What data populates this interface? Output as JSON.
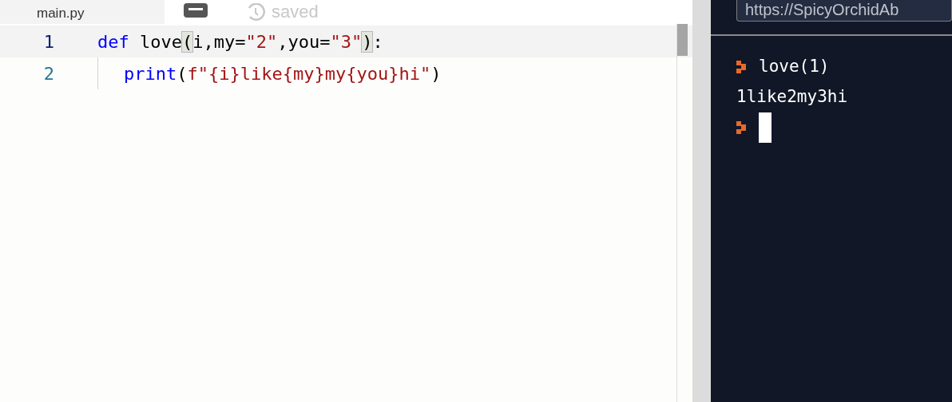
{
  "editor": {
    "tab": {
      "label": "main.py"
    },
    "status": {
      "label": "saved"
    },
    "lines": [
      {
        "number": "1",
        "active": true,
        "tokens": [
          {
            "kind": "keyword",
            "text": "def"
          },
          {
            "kind": "plain",
            "text": " love"
          },
          {
            "kind": "match",
            "text": "("
          },
          {
            "kind": "plain",
            "text": "i,my="
          },
          {
            "kind": "string",
            "text": "\"2\""
          },
          {
            "kind": "plain",
            "text": ",you="
          },
          {
            "kind": "string",
            "text": "\"3\""
          },
          {
            "kind": "match",
            "text": ")"
          },
          {
            "kind": "plain",
            "text": ":"
          }
        ],
        "children": [
          {
            "number": "2",
            "active": false,
            "tokens": [
              {
                "kind": "keyword",
                "text": "print"
              },
              {
                "kind": "plain",
                "text": "("
              },
              {
                "kind": "string",
                "text": "f\"{i}like{my}my{you}hi\""
              },
              {
                "kind": "plain",
                "text": ")"
              }
            ]
          }
        ]
      }
    ]
  },
  "console": {
    "url": "https://SpicyOrchidAb",
    "lines": [
      {
        "kind": "input",
        "text": "love(1)"
      },
      {
        "kind": "output",
        "text": "1like2my3hi"
      },
      {
        "kind": "cursor"
      }
    ]
  }
}
